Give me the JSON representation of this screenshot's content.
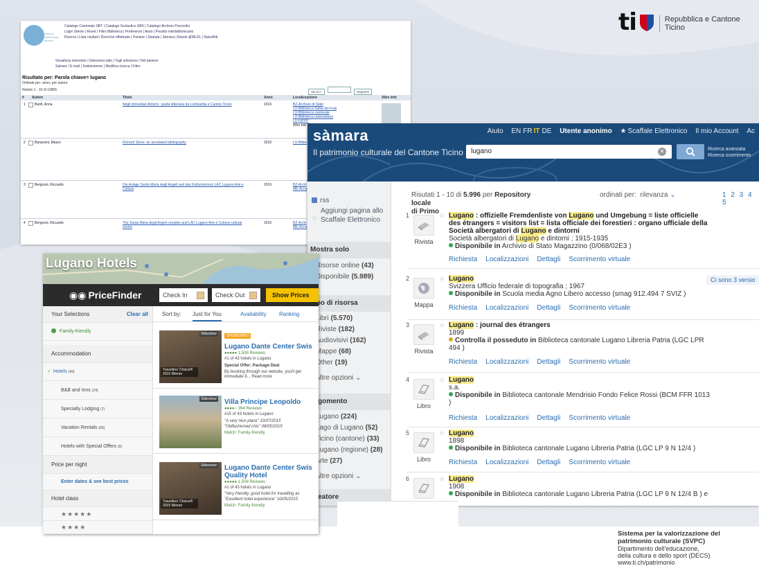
{
  "org": {
    "logo": "ti",
    "name_line1": "Repubblica e Cantone",
    "name_line2": "Ticino"
  },
  "footer": {
    "line1": "Sistema per la valorizzazione del",
    "line2": "patrimonio culturale (SVPC)",
    "line3": "Dipartimento dell'educazione,",
    "line4": "della cultura e dello sport (DECS)",
    "line5": "www.ti.ch/patrimonio"
  },
  "catalog": {
    "menu1": "Catalogo Cantonale SBT | Catalogo Scolastico SBS | Catalogo Archivio Prezzolini",
    "menu2": "Login Utente | Reset | Filtro Biblioteca | Preferenze | Aiuto | Prestito interbibliotecario",
    "menu3": "Ricerca | Lista risultati | Ricerche effettuate | Paniere | Stampa | Sàmara | Ebook @MLOL | SwissBib",
    "actions1": "Visualizza selezione | Seleziona tutto | Togli selezione | Nel paniere",
    "actions2": "Salvare / E-mail | Sottoinsieme | Modifica ricerca | Filtro",
    "result_title": "Risultato per: Parola chiave= lugano",
    "sort": "Ordinati per: anno, per autore",
    "count": "Notizie 1 - 10 di 10865",
    "goto": "Vai al n.",
    "next": "Seguenti",
    "headers": {
      "num": "#",
      "author": "Autore",
      "title": "Titolo",
      "year": "Anno",
      "loc": "Localizzazione",
      "more": "Altre info"
    },
    "rows": [
      {
        "n": "1",
        "author": "Banfi, Anna",
        "title": "Negli immediati dintorni : guida letteraria tra Lombardia e Canton Ticino",
        "year": "2016",
        "l1": "BZ-Archivio di Stato",
        "l2": "LU-Biblioteca Salita dei Frati",
        "l3": "LU-Biblioteca cantonale",
        "l4": "LU-Biblioteca universitaria",
        "l5": "LU-IUFFP",
        "l6": "Altre bibl"
      },
      {
        "n": "2",
        "author": "Baranzini, Mauro",
        "title": "Richard Stone: an annotated bibliography",
        "year": "2016",
        "l1": "LU-Biblio"
      },
      {
        "n": "3",
        "author": "Bergossi, Riccardo",
        "title": "Die Anlage Santa Maria degli Angeli und das Kulturzentrum LAC Lugano Arte e",
        "title2": "Cultura",
        "year": "2016",
        "l1": "BZ-Archi",
        "l2": "ME-Acca"
      },
      {
        "n": "4",
        "author": "Bergossi, Riccardo",
        "title": "The Santa Maria degli Angeli complex and LAC Lugano Arte e Cultura cultural",
        "title2": "centre",
        "year": "2016",
        "l1": "BZ-Archi",
        "l2": "ME-Acca"
      }
    ]
  },
  "samara": {
    "brand": "sàmara",
    "subtitle": "Il patrimonio culturale del Cantone Ticino",
    "links": {
      "help": "Aiuto",
      "en": "EN",
      "fr": "FR",
      "it": "IT",
      "de": "DE",
      "user": "Utente anonimo",
      "shelf": "Scaffale Elettronico",
      "account": "Il mio Account",
      "cut": "Ac"
    },
    "search_value": "lugano",
    "adv1": "Ricerca avanzata",
    "adv2": "Ricerca scorrimento",
    "rss": "rss",
    "add1": "Aggiungi pagina allo",
    "add2": "Scaffale Elettronico",
    "facets": {
      "show_only": "Mostra solo",
      "online": "Risorse online",
      "online_n": "(43)",
      "available": "Disponibile",
      "available_n": "(5.989)",
      "type_h": "Tipo di risorsa",
      "books": "Libri",
      "books_n": "(5.570)",
      "mags": "Riviste",
      "mags_n": "(182)",
      "av": "Audiovisivi",
      "av_n": "(162)",
      "maps": "Mappe",
      "maps_n": "(68)",
      "other": "Other",
      "other_n": "(19)",
      "more1": "Altre opzioni",
      "subject_h": "Argomento",
      "s1": "Lugano",
      "s1_n": "(224)",
      "s2": "Lago di Lugano",
      "s2_n": "(52)",
      "s3": "Ticino (cantone)",
      "s3_n": "(33)",
      "s4": "Lugano (regione)",
      "s4_n": "(28)",
      "s5": "Arte",
      "s5_n": "(27)",
      "more2": "Altre opzioni",
      "creator_h": "Creatore"
    },
    "results_label": "Risutati 1 - 10 di",
    "results_total": "5.996",
    "results_per": "per",
    "results_repo": "Repository locale",
    "results_line2": "di Primo",
    "order": "ordinati per:",
    "order_val": "rilevanza",
    "pages": "1 2 3 4 5",
    "actions": {
      "request": "Richiesta",
      "loc": "Localizzazioni",
      "details": "Dettagli",
      "browse": "Scorrimento virtuale"
    },
    "versions": "Ci sono 3 versio",
    "records": [
      {
        "n": "1",
        "type": "Rivista",
        "t_a": "Lugano",
        "t_b": " : offizielle Fremdenliste von ",
        "t_c": "Lugano",
        "t_d": " und Umgebung = liste officielle",
        "t2": "des étrangers = visitors list = lista officiale dei forestieri : organo ufficiale della",
        "t3a": "Società albergatori di ",
        "t3b": "Lugano",
        "t3c": " e dintorni",
        "sub_a": "Società albergatori di ",
        "sub_b": "Lugano",
        "sub_c": " e dintorni ; 1915-1935",
        "avail": "Disponibile in",
        "where": "Archivio di Stato Magazzino (0/068/02E3 )"
      },
      {
        "n": "2",
        "type": "Mappa",
        "t_a": "Lugano",
        "sub": "Svizzera Ufficio federale di topografia ; 1967",
        "avail": "Disponibile in",
        "where": "Scuola media Agno Libero accesso (smag 912.494 7 SVIZ )"
      },
      {
        "n": "3",
        "type": "Rivista",
        "t_a": "Lugano",
        "t_b": " : journal des étrangers",
        "sub": "1899",
        "avail": "Controlla il posseduto in",
        "where": "Biblioteca cantonale Lugano Libreria Patria (LGC LPR",
        "where2": "494 )"
      },
      {
        "n": "4",
        "type": "Libro",
        "t_a": "Lugano",
        "sub": "s.a.",
        "avail": "Disponibile in",
        "where": "Biblioteca cantonale Mendrisio Fondo Felice Rossi (BCM FFR 1013",
        "where2": ")"
      },
      {
        "n": "5",
        "type": "Libro",
        "t_a": "Lugano",
        "sub": "1898",
        "avail": "Disponibile in",
        "where": "Biblioteca cantonale Lugano Libreria Patria (LGC LP 9 N 12/4 )"
      },
      {
        "n": "6",
        "type": "",
        "t_a": "Lugano",
        "sub": "1908",
        "avail": "Disponibile in",
        "where": "Biblioteca cantonale Lugano Libreria Patria (LGC LP 9 N 12/4 B ) e"
      }
    ]
  },
  "hotels": {
    "title": "Lugano Hotels",
    "brand": "PriceFinder",
    "checkin": "Check In",
    "checkout": "Check Out",
    "show": "Show Prices",
    "your_sel": "Your Selections",
    "clear": "Clear all",
    "family": "Family-friendly",
    "accom": "Accommodation",
    "hotels_f": "Hotels",
    "hotels_n": "(43)",
    "bb": "B&B and Inns",
    "bb_n": "(24)",
    "special": "Specialty Lodging",
    "special_n": "(7)",
    "vac": "Vacation Rentals",
    "vac_n": "(69)",
    "offers": "Hotels with Special Offers",
    "offers_n": "(9)",
    "price": "Price per night",
    "dates": "Enter dates & see best prices",
    "class": "Hotel class",
    "s5": "★★★★★",
    "s4": "★★★★",
    "s3": "★★★",
    "sortby": "Sort by:",
    "sort1": "Just for You",
    "sort2": "Availability",
    "sort3": "Ranking",
    "slideshow": "Slideshow",
    "tc": "Travellers' Choice® 2015 Winner",
    "cards": [
      {
        "sponsored": "SPONSORED",
        "name": "Lugano Dante Center Swis",
        "reviews": "●●●●● 1,508 Reviews",
        "rank": "#1 of 43 hotels in Lugano",
        "l1": "Special Offer: Package Deal",
        "l2": "By booking through our website, you'll get",
        "l3": "immediate 8... Read more"
      },
      {
        "name": "Villa Principe Leopoldo",
        "reviews": "●●●●○ 394 Reviews",
        "rank": "#15 of 43 hotels in Lugano",
        "l1": "\"A very nice place\" 10/07/2015",
        "l2": "\"Oldfashioned chic\" 08/05/2015",
        "l3": "Match: Family-friendly"
      },
      {
        "name": "Lugano Dante Center Swis",
        "name2": "Quality Hotel",
        "reviews": "●●●●● 1,508 Reviews",
        "rank": "#1 of 43 hotels in Lugano",
        "l1": "\"Very friendly, good hotel for travelling as",
        "l2": "\"Excellent hotel experience\" 10/05/2015",
        "l3": "Match: Family-friendly"
      }
    ]
  }
}
